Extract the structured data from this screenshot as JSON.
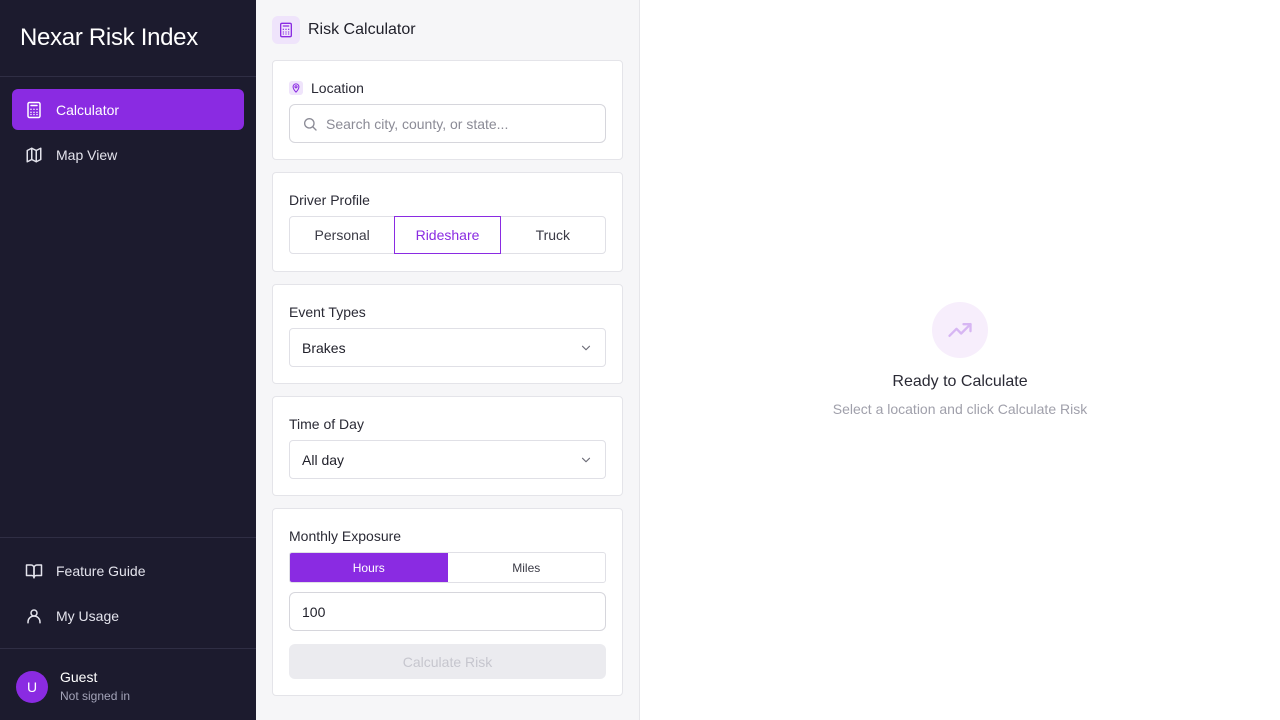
{
  "sidebar": {
    "brand": "Nexar Risk Index",
    "nav": [
      {
        "label": "Calculator",
        "icon": "calculator-icon",
        "active": true
      },
      {
        "label": "Map View",
        "icon": "map-icon",
        "active": false
      }
    ],
    "bottom_nav": [
      {
        "label": "Feature Guide",
        "icon": "book-icon"
      },
      {
        "label": "My Usage",
        "icon": "user-icon"
      }
    ],
    "user": {
      "initial": "U",
      "name": "Guest",
      "status": "Not signed in"
    }
  },
  "panel": {
    "title": "Risk Calculator",
    "location": {
      "label": "Location",
      "placeholder": "Search city, county, or state...",
      "value": ""
    },
    "driver_profile": {
      "label": "Driver Profile",
      "options": [
        "Personal",
        "Rideshare",
        "Truck"
      ],
      "selected": "Rideshare"
    },
    "event_types": {
      "label": "Event Types",
      "selected": "Brakes"
    },
    "time_of_day": {
      "label": "Time of Day",
      "selected": "All day"
    },
    "monthly_exposure": {
      "label": "Monthly Exposure",
      "options": [
        "Hours",
        "Miles"
      ],
      "selected": "Hours",
      "value": "100"
    },
    "calculate_label": "Calculate Risk"
  },
  "result": {
    "title": "Ready to Calculate",
    "subtitle": "Select a location and click Calculate Risk"
  },
  "colors": {
    "accent": "#8a2be2",
    "sidebar_bg": "#1c1b2e"
  }
}
